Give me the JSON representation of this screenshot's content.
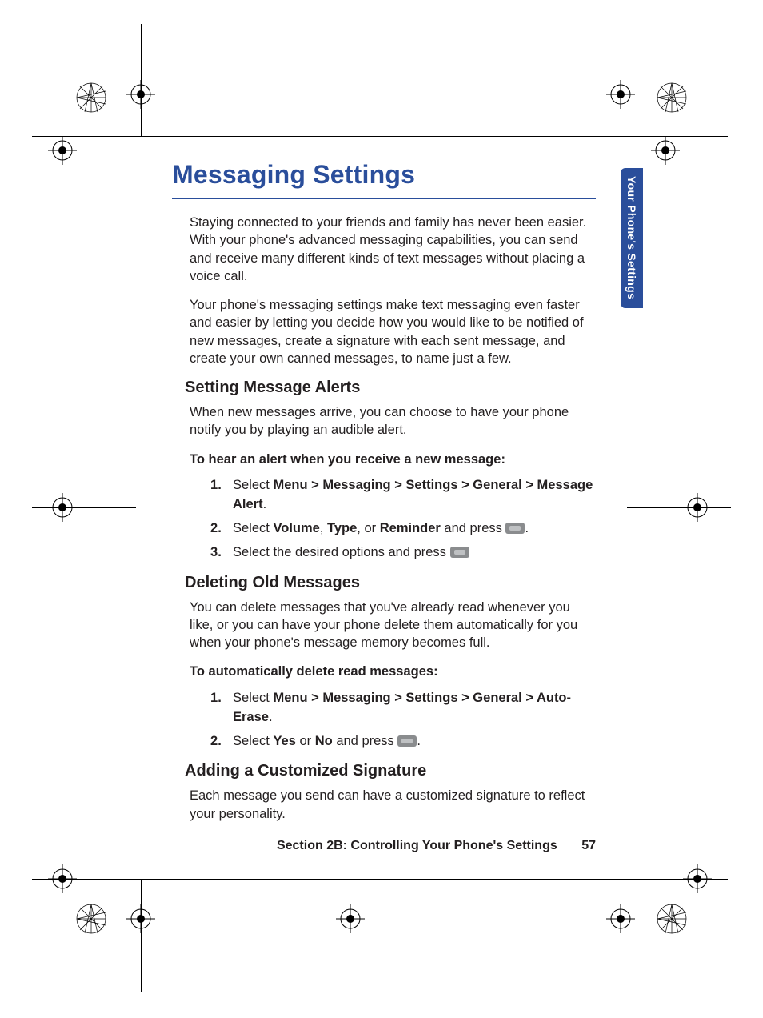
{
  "title": "Messaging Settings",
  "thumb_tab": "Your Phone's Settings",
  "intro": [
    "Staying connected to your friends and family has never been easier. With your phone's advanced messaging capabilities, you can send and receive many different kinds of text messages without placing a voice call.",
    "Your phone's messaging settings make text messaging even faster and easier by letting you decide how you would like to be notified of new messages, create a signature with each sent message, and create your own canned messages, to name just a few."
  ],
  "sections": [
    {
      "heading": "Setting Message Alerts",
      "body": "When new messages arrive, you can choose to have your phone notify you by playing an audible alert.",
      "lead": "To hear an alert when you receive a new message:",
      "steps": [
        {
          "pre": "Select ",
          "bold": "Menu > Messaging > Settings > General > Message Alert",
          "post": "."
        },
        {
          "pre": "Select ",
          "bold_parts": [
            "Volume",
            "Type",
            "Reminder"
          ],
          "joins": [
            ", ",
            ", or "
          ],
          "post": " and press ",
          "btn": true,
          "tail": "."
        },
        {
          "pre": "Select the desired options and press ",
          "btn": true,
          "tail": ""
        }
      ]
    },
    {
      "heading": "Deleting Old Messages",
      "body": "You can delete messages that you've already read whenever you like, or you can have your phone delete them automatically for you when your phone's message memory becomes full.",
      "lead": "To automatically delete read messages:",
      "steps": [
        {
          "pre": "Select ",
          "bold": "Menu > Messaging > Settings > General > Auto-Erase",
          "post": "."
        },
        {
          "pre": "Select ",
          "bold_parts": [
            "Yes",
            "No"
          ],
          "joins": [
            " or "
          ],
          "post": " and press ",
          "btn": true,
          "tail": "."
        }
      ]
    },
    {
      "heading": "Adding a Customized Signature",
      "body": "Each message you send can have a customized signature to reflect your personality."
    }
  ],
  "footer": {
    "section": "Section 2B: Controlling Your Phone's Settings",
    "page": "57"
  }
}
